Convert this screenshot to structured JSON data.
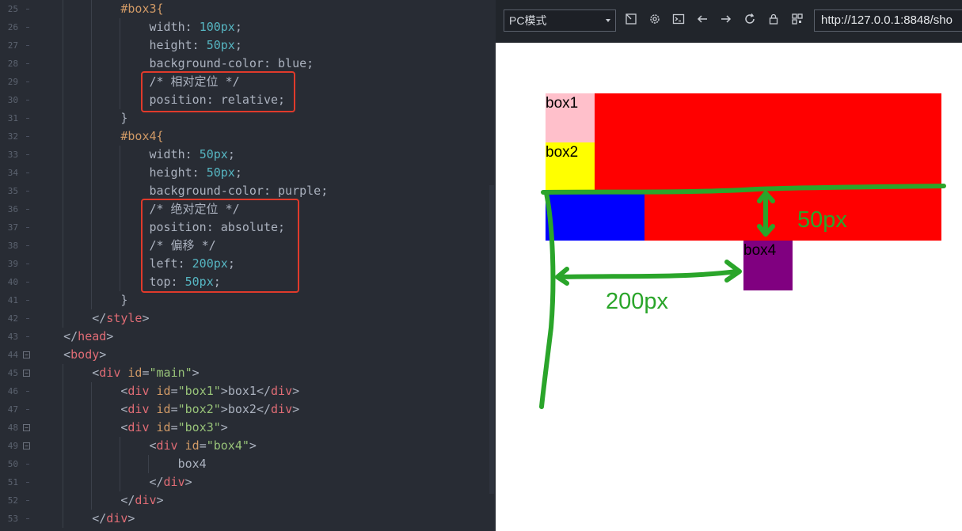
{
  "editor": {
    "lines": [
      {
        "n": "25",
        "fold": false,
        "indent": 3,
        "tokens": [
          [
            "sel",
            "#box3{"
          ]
        ]
      },
      {
        "n": "26",
        "fold": false,
        "indent": 4,
        "tokens": [
          [
            "prop",
            "width: "
          ],
          [
            "num",
            "100px"
          ],
          [
            "prop",
            ";"
          ]
        ]
      },
      {
        "n": "27",
        "fold": false,
        "indent": 4,
        "tokens": [
          [
            "prop",
            "height: "
          ],
          [
            "num",
            "50px"
          ],
          [
            "prop",
            ";"
          ]
        ]
      },
      {
        "n": "28",
        "fold": false,
        "indent": 4,
        "tokens": [
          [
            "prop",
            "background-color: blue;"
          ]
        ]
      },
      {
        "n": "29",
        "fold": false,
        "indent": 4,
        "tokens": [
          [
            "cmt",
            "/* 相对定位 */"
          ]
        ]
      },
      {
        "n": "30",
        "fold": false,
        "indent": 4,
        "tokens": [
          [
            "prop",
            "position: relative;"
          ]
        ]
      },
      {
        "n": "31",
        "fold": false,
        "indent": 3,
        "tokens": [
          [
            "prop",
            "}"
          ]
        ]
      },
      {
        "n": "32",
        "fold": false,
        "indent": 3,
        "tokens": [
          [
            "sel",
            "#box4{"
          ]
        ]
      },
      {
        "n": "33",
        "fold": false,
        "indent": 4,
        "tokens": [
          [
            "prop",
            "width: "
          ],
          [
            "num",
            "50px"
          ],
          [
            "prop",
            ";"
          ]
        ]
      },
      {
        "n": "34",
        "fold": false,
        "indent": 4,
        "tokens": [
          [
            "prop",
            "height: "
          ],
          [
            "num",
            "50px"
          ],
          [
            "prop",
            ";"
          ]
        ]
      },
      {
        "n": "35",
        "fold": false,
        "indent": 4,
        "tokens": [
          [
            "prop",
            "background-color: purple;"
          ]
        ]
      },
      {
        "n": "36",
        "fold": false,
        "indent": 4,
        "tokens": [
          [
            "cmt",
            "/* 绝对定位 */"
          ]
        ]
      },
      {
        "n": "37",
        "fold": false,
        "indent": 4,
        "tokens": [
          [
            "prop",
            "position: absolute;"
          ]
        ]
      },
      {
        "n": "38",
        "fold": false,
        "indent": 4,
        "tokens": [
          [
            "cmt",
            "/* 偏移 */"
          ]
        ]
      },
      {
        "n": "39",
        "fold": false,
        "indent": 4,
        "tokens": [
          [
            "prop",
            "left: "
          ],
          [
            "num",
            "200px"
          ],
          [
            "prop",
            ";"
          ]
        ]
      },
      {
        "n": "40",
        "fold": false,
        "indent": 4,
        "tokens": [
          [
            "prop",
            "top: "
          ],
          [
            "num",
            "50px"
          ],
          [
            "prop",
            ";"
          ]
        ]
      },
      {
        "n": "41",
        "fold": false,
        "indent": 3,
        "tokens": [
          [
            "prop",
            "}"
          ]
        ]
      },
      {
        "n": "42",
        "fold": false,
        "indent": 2,
        "tokens": [
          [
            "prop",
            "</"
          ],
          [
            "tag",
            "style"
          ],
          [
            "prop",
            ">"
          ]
        ]
      },
      {
        "n": "43",
        "fold": false,
        "indent": 1,
        "tokens": [
          [
            "prop",
            "</"
          ],
          [
            "tag",
            "head"
          ],
          [
            "prop",
            ">"
          ]
        ]
      },
      {
        "n": "44",
        "fold": true,
        "indent": 1,
        "tokens": [
          [
            "prop",
            "<"
          ],
          [
            "tag",
            "body"
          ],
          [
            "prop",
            ">"
          ]
        ]
      },
      {
        "n": "45",
        "fold": true,
        "indent": 2,
        "tokens": [
          [
            "prop",
            "<"
          ],
          [
            "tag",
            "div"
          ],
          [
            "prop",
            " "
          ],
          [
            "attr",
            "id"
          ],
          [
            "prop",
            "="
          ],
          [
            "str",
            "\"main\""
          ],
          [
            "prop",
            ">"
          ]
        ]
      },
      {
        "n": "46",
        "fold": false,
        "indent": 3,
        "tokens": [
          [
            "prop",
            "<"
          ],
          [
            "tag",
            "div"
          ],
          [
            "prop",
            " "
          ],
          [
            "attr",
            "id"
          ],
          [
            "prop",
            "="
          ],
          [
            "str",
            "\"box1\""
          ],
          [
            "prop",
            ">box1</"
          ],
          [
            "tag",
            "div"
          ],
          [
            "prop",
            ">"
          ]
        ]
      },
      {
        "n": "47",
        "fold": false,
        "indent": 3,
        "tokens": [
          [
            "prop",
            "<"
          ],
          [
            "tag",
            "div"
          ],
          [
            "prop",
            " "
          ],
          [
            "attr",
            "id"
          ],
          [
            "prop",
            "="
          ],
          [
            "str",
            "\"box2\""
          ],
          [
            "prop",
            ">box2</"
          ],
          [
            "tag",
            "div"
          ],
          [
            "prop",
            ">"
          ]
        ]
      },
      {
        "n": "48",
        "fold": true,
        "indent": 3,
        "tokens": [
          [
            "prop",
            "<"
          ],
          [
            "tag",
            "div"
          ],
          [
            "prop",
            " "
          ],
          [
            "attr",
            "id"
          ],
          [
            "prop",
            "="
          ],
          [
            "str",
            "\"box3\""
          ],
          [
            "prop",
            ">"
          ]
        ]
      },
      {
        "n": "49",
        "fold": true,
        "indent": 4,
        "tokens": [
          [
            "prop",
            "<"
          ],
          [
            "tag",
            "div"
          ],
          [
            "prop",
            " "
          ],
          [
            "attr",
            "id"
          ],
          [
            "prop",
            "="
          ],
          [
            "str",
            "\"box4\""
          ],
          [
            "prop",
            ">"
          ]
        ]
      },
      {
        "n": "50",
        "fold": false,
        "indent": 5,
        "tokens": [
          [
            "prop",
            "box4"
          ]
        ]
      },
      {
        "n": "51",
        "fold": false,
        "indent": 4,
        "tokens": [
          [
            "prop",
            "</"
          ],
          [
            "tag",
            "div"
          ],
          [
            "prop",
            ">"
          ]
        ]
      },
      {
        "n": "52",
        "fold": false,
        "indent": 3,
        "tokens": [
          [
            "prop",
            "</"
          ],
          [
            "tag",
            "div"
          ],
          [
            "prop",
            ">"
          ]
        ]
      },
      {
        "n": "53",
        "fold": false,
        "indent": 2,
        "tokens": [
          [
            "prop",
            "</"
          ],
          [
            "tag",
            "div"
          ],
          [
            "prop",
            ">"
          ]
        ]
      }
    ]
  },
  "browser": {
    "mode": "PC模式",
    "url": "http://127.0.0.1:8848/sho",
    "toolbar_icons": [
      "screenshot-icon",
      "settings-icon",
      "console-icon",
      "back-icon",
      "forward-icon",
      "refresh-icon",
      "lock-icon",
      "qrcode-icon"
    ],
    "boxes": {
      "box1": "box1",
      "box2": "box2",
      "box4": "box4"
    },
    "annotations": {
      "vertical_offset": "50px",
      "horizontal_offset": "200px"
    }
  },
  "colors": {
    "editor_bg": "#282c34",
    "highlight_border": "#e03a2b",
    "annotation_green": "#2aa52a",
    "main": "#ff0000",
    "box1": "#ffc0cb",
    "box2": "#ffff00",
    "box3": "#0000ff",
    "box4": "#800080"
  }
}
